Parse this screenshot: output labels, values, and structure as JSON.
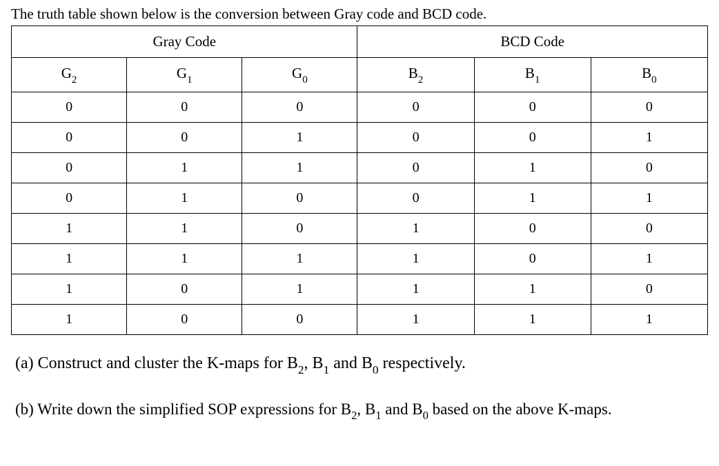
{
  "intro": "The truth table shown below is the conversion between Gray code and BCD code.",
  "headers": {
    "gray": "Gray Code",
    "bcd": "BCD Code"
  },
  "cols": {
    "g2_base": "G",
    "g2_sub": "2",
    "g1_base": "G",
    "g1_sub": "1",
    "g0_base": "G",
    "g0_sub": "0",
    "b2_base": "B",
    "b2_sub": "2",
    "b1_base": "B",
    "b1_sub": "1",
    "b0_base": "B",
    "b0_sub": "0"
  },
  "rows": [
    {
      "g2": "0",
      "g1": "0",
      "g0": "0",
      "b2": "0",
      "b1": "0",
      "b0": "0"
    },
    {
      "g2": "0",
      "g1": "0",
      "g0": "1",
      "b2": "0",
      "b1": "0",
      "b0": "1"
    },
    {
      "g2": "0",
      "g1": "1",
      "g0": "1",
      "b2": "0",
      "b1": "1",
      "b0": "0"
    },
    {
      "g2": "0",
      "g1": "1",
      "g0": "0",
      "b2": "0",
      "b1": "1",
      "b0": "1"
    },
    {
      "g2": "1",
      "g1": "1",
      "g0": "0",
      "b2": "1",
      "b1": "0",
      "b0": "0"
    },
    {
      "g2": "1",
      "g1": "1",
      "g0": "1",
      "b2": "1",
      "b1": "0",
      "b0": "1"
    },
    {
      "g2": "1",
      "g1": "0",
      "g0": "1",
      "b2": "1",
      "b1": "1",
      "b0": "0"
    },
    {
      "g2": "1",
      "g1": "0",
      "g0": "0",
      "b2": "1",
      "b1": "1",
      "b0": "1"
    }
  ],
  "qa": {
    "label": "(a) Construct and cluster the K-maps for ",
    "b2_base": "B",
    "b2_sub": "2",
    "mid1": ", ",
    "b1_base": "B",
    "b1_sub": "1",
    "mid2": " and ",
    "b0_base": "B",
    "b0_sub": "0",
    "tail": " respectively."
  },
  "qb": {
    "label": "(b) Write down the simplified SOP expressions for ",
    "b2_base": "B",
    "b2_sub": "2",
    "mid1": ", ",
    "b1_base": "B",
    "b1_sub": "1",
    "mid2": " and ",
    "b0_base": "B",
    "b0_sub": "0",
    "tail_pre": " based on the above K-maps."
  }
}
